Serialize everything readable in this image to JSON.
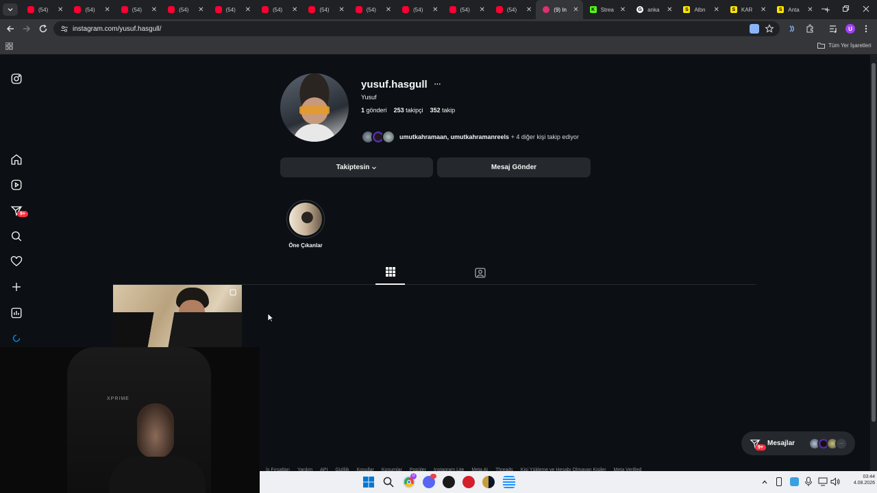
{
  "browser": {
    "tabs": [
      {
        "title": "(54)",
        "type": "youtube"
      },
      {
        "title": "(54)",
        "type": "youtube"
      },
      {
        "title": "(54)",
        "type": "youtube"
      },
      {
        "title": "(54)",
        "type": "youtube"
      },
      {
        "title": "(54)",
        "type": "youtube"
      },
      {
        "title": "(54)",
        "type": "youtube"
      },
      {
        "title": "(54)",
        "type": "youtube"
      },
      {
        "title": "(54)",
        "type": "youtube"
      },
      {
        "title": "(54)",
        "type": "youtube"
      },
      {
        "title": "(54)",
        "type": "youtube"
      },
      {
        "title": "(54)",
        "type": "youtube"
      },
      {
        "title": "(9) In",
        "type": "instagram",
        "active": true
      },
      {
        "title": "Strea",
        "type": "kick"
      },
      {
        "title": "anka",
        "type": "google"
      },
      {
        "title": "Albn",
        "type": "s"
      },
      {
        "title": "KAR",
        "type": "s"
      },
      {
        "title": "Anta",
        "type": "s"
      }
    ],
    "url": "instagram.com/yusuf.hasgull/",
    "bookmarks_label": "Tüm Yer İşaretleri",
    "profile_initial": "U"
  },
  "sidebar": {
    "messages_badge": "9+"
  },
  "profile": {
    "username": "yusuf.hasgull",
    "more_label": "···",
    "full_name": "Yusuf",
    "posts_count": "1",
    "posts_label": "gönderi",
    "followers_count": "253",
    "followers_label": "takipçi",
    "following_count": "352",
    "following_label": "takip",
    "followed_by_names": "umutkahramaan, umutkahramanreels",
    "followed_by_rest": " + 4 diğer kişi takip ediyor",
    "following_button": "Takiptesin",
    "message_button": "Mesaj Gönder",
    "highlight_label": "Öne Çıkanlar"
  },
  "messages_widget": {
    "label": "Mesajlar",
    "badge": "9+"
  },
  "footer": [
    "İş Fırsatları",
    "Yardım",
    "API",
    "Gizlilik",
    "Koşullar",
    "Konumlar",
    "Popüler",
    "Instagram Lite",
    "Meta AI",
    "Threads",
    "Kişi Yükleme ve Hesabı Olmayan Kişiler",
    "Meta Verified"
  ],
  "taskbar": {
    "time": "03:44",
    "date": "4.08.2026",
    "chrome_badge": "U"
  },
  "webcam": {
    "logo_text": "XPRIME"
  },
  "colors": {
    "page_bg": "#0c1014",
    "button_bg": "#25292e",
    "badge_red": "#ff3040"
  }
}
